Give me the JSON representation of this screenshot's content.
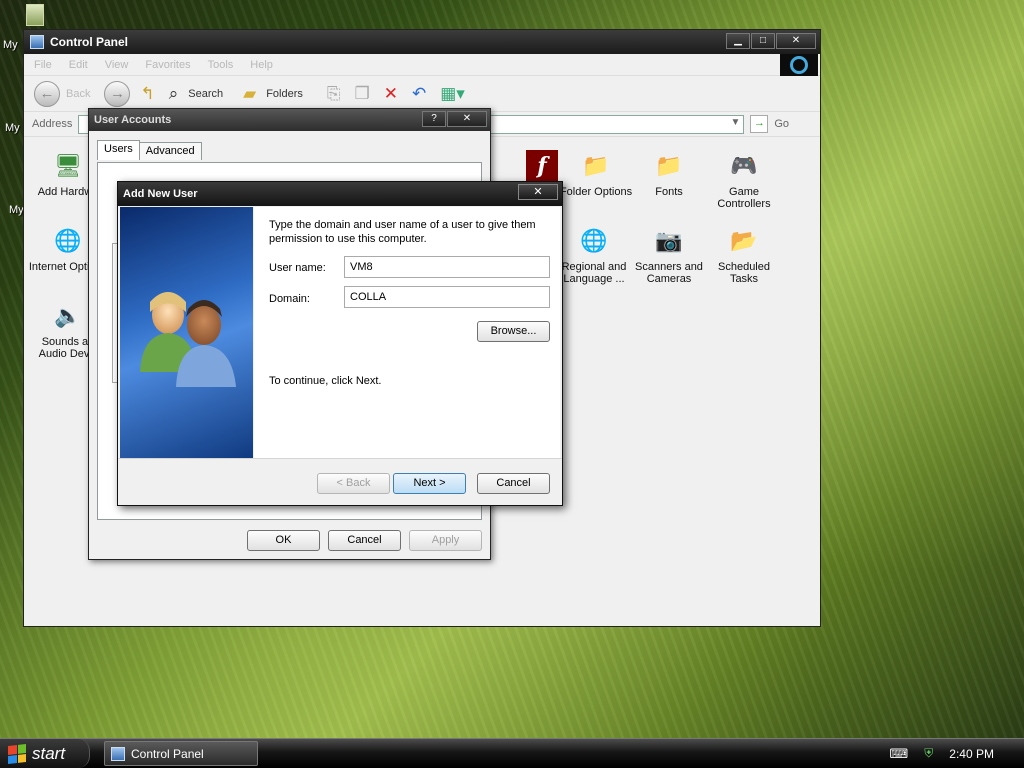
{
  "desktop": {
    "labels": [
      "My",
      "My",
      "My"
    ]
  },
  "control_panel": {
    "title": "Control Panel",
    "menu": [
      "File",
      "Edit",
      "View",
      "Favorites",
      "Tools",
      "Help"
    ],
    "toolbar": {
      "back": "Back",
      "search": "Search",
      "folders": "Folders"
    },
    "address_label": "Address",
    "go_label": "Go",
    "items": [
      {
        "label": "Add Hardwa",
        "icon": "add-hardware-icon"
      },
      {
        "label": "Internet Options",
        "icon": "internet-options-icon"
      },
      {
        "label": "Sounds an Audio Devic",
        "icon": "sounds-icon"
      },
      {
        "label": "Folder Options",
        "icon": "folder-options-icon"
      },
      {
        "label": "Fonts",
        "icon": "fonts-icon"
      },
      {
        "label": "Game Controllers",
        "icon": "game-controllers-icon"
      },
      {
        "label": "Regional and Language ...",
        "icon": "regional-icon"
      },
      {
        "label": "Scanners and Cameras",
        "icon": "scanners-icon"
      },
      {
        "label": "Scheduled Tasks",
        "icon": "scheduled-tasks-icon"
      },
      {
        "label": "",
        "icon": "flash-icon"
      }
    ]
  },
  "user_accounts": {
    "title": "User Accounts",
    "tabs": [
      "Users",
      "Advanced"
    ],
    "buttons": {
      "ok": "OK",
      "cancel": "Cancel",
      "apply": "Apply"
    }
  },
  "add_new_user": {
    "title": "Add New User",
    "intro": "Type the domain and user name of a user to give them permission to use this computer.",
    "username_label": "User name:",
    "username_value": "VM8",
    "domain_label": "Domain:",
    "domain_value": "COLLA",
    "browse": "Browse...",
    "continue_text": "To continue, click Next.",
    "buttons": {
      "back": "< Back",
      "next": "Next >",
      "cancel": "Cancel"
    }
  },
  "taskbar": {
    "start": "start",
    "task": "Control Panel",
    "time": "2:40 PM"
  }
}
